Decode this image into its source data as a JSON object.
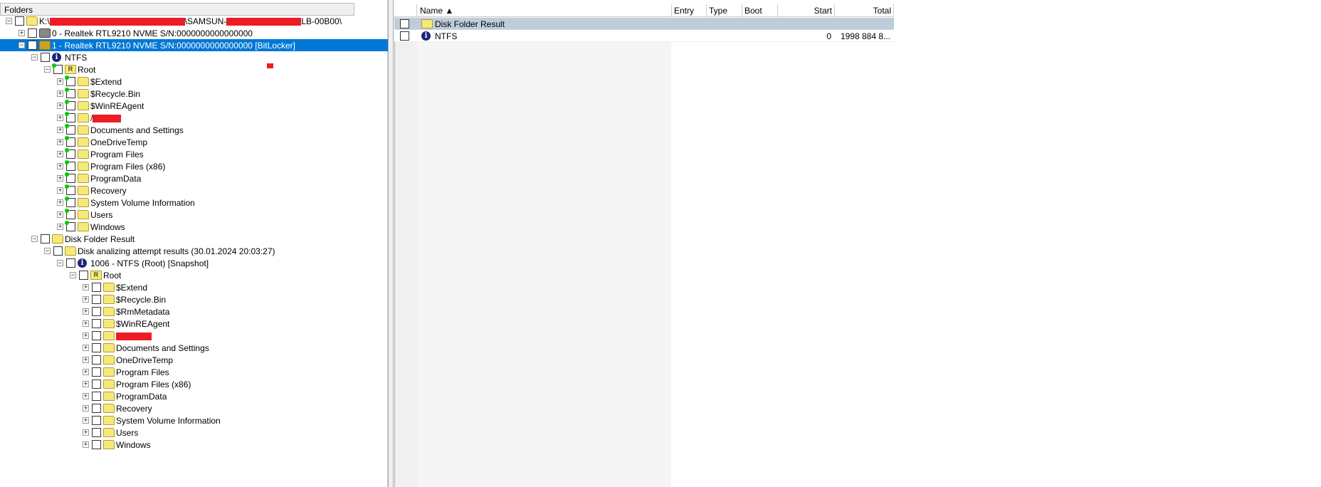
{
  "left_panel": {
    "header": "Folders"
  },
  "tree": [
    {
      "level": 0,
      "exp": "-",
      "icon": "drives",
      "text": "K:\\",
      "redact": [
        190,
        "\\SAMSUN-",
        105,
        "LB-00B00\\"
      ]
    },
    {
      "level": 1,
      "exp": "+",
      "icon": "disk",
      "text": "0 - Realtek RTL9210 NVME  S/N:0000000000000000"
    },
    {
      "level": 1,
      "exp": "-",
      "icon": "disk-lock",
      "text": "1 - Realtek RTL9210 NVME  S/N:0000000000000000 [BitLocker]",
      "selected": true
    },
    {
      "level": 2,
      "exp": "-",
      "icon": "info",
      "text": "NTFS"
    },
    {
      "level": 3,
      "exp": "-",
      "icon": "root",
      "text": "Root",
      "dot": true
    },
    {
      "level": 4,
      "exp": "+",
      "icon": "folder",
      "text": "$Extend",
      "dot": true
    },
    {
      "level": 4,
      "exp": "+",
      "icon": "folder",
      "text": "$Recycle.Bin",
      "dot": true
    },
    {
      "level": 4,
      "exp": "+",
      "icon": "folder",
      "text": "$WinREAgent",
      "dot": true
    },
    {
      "level": 4,
      "exp": "+",
      "icon": "folder",
      "text": "/",
      "dot": true,
      "redact": [
        40
      ]
    },
    {
      "level": 4,
      "exp": "+",
      "icon": "folder",
      "text": "Documents and Settings",
      "dot": true
    },
    {
      "level": 4,
      "exp": "+",
      "icon": "folder",
      "text": "OneDriveTemp",
      "dot": true
    },
    {
      "level": 4,
      "exp": "+",
      "icon": "folder",
      "text": "Program Files",
      "dot": true
    },
    {
      "level": 4,
      "exp": "+",
      "icon": "folder",
      "text": "Program Files (x86)",
      "dot": true
    },
    {
      "level": 4,
      "exp": "+",
      "icon": "folder",
      "text": "ProgramData",
      "dot": true
    },
    {
      "level": 4,
      "exp": "+",
      "icon": "folder",
      "text": "Recovery",
      "dot": true
    },
    {
      "level": 4,
      "exp": "+",
      "icon": "folder",
      "text": "System Volume Information",
      "dot": true
    },
    {
      "level": 4,
      "exp": "+",
      "icon": "folder",
      "text": "Users",
      "dot": true
    },
    {
      "level": 4,
      "exp": "+",
      "icon": "folder",
      "text": "Windows",
      "dot": true
    },
    {
      "level": 2,
      "exp": "-",
      "icon": "folder",
      "text": "Disk Folder Result"
    },
    {
      "level": 3,
      "exp": "-",
      "icon": "folder",
      "text": "Disk analizing attempt results (30.01.2024 20:03:27)"
    },
    {
      "level": 4,
      "exp": "-",
      "icon": "info",
      "text": "1006 - NTFS (Root)  [Snapshot]"
    },
    {
      "level": 5,
      "exp": "-",
      "icon": "root",
      "text": "Root"
    },
    {
      "level": 6,
      "exp": "+",
      "icon": "folder",
      "text": "$Extend"
    },
    {
      "level": 6,
      "exp": "+",
      "icon": "folder",
      "text": "$Recycle.Bin"
    },
    {
      "level": 6,
      "exp": "+",
      "icon": "folder",
      "text": "$RmMetadata"
    },
    {
      "level": 6,
      "exp": "+",
      "icon": "folder",
      "text": "$WinREAgent"
    },
    {
      "level": 6,
      "exp": "+",
      "icon": "folder",
      "text": "",
      "redact": [
        50
      ]
    },
    {
      "level": 6,
      "exp": "+",
      "icon": "folder",
      "text": "Documents and Settings"
    },
    {
      "level": 6,
      "exp": "+",
      "icon": "folder",
      "text": "OneDriveTemp"
    },
    {
      "level": 6,
      "exp": "+",
      "icon": "folder",
      "text": "Program Files"
    },
    {
      "level": 6,
      "exp": "+",
      "icon": "folder",
      "text": "Program Files (x86)"
    },
    {
      "level": 6,
      "exp": "+",
      "icon": "folder",
      "text": "ProgramData"
    },
    {
      "level": 6,
      "exp": "+",
      "icon": "folder",
      "text": "Recovery"
    },
    {
      "level": 6,
      "exp": "+",
      "icon": "folder",
      "text": "System Volume Information"
    },
    {
      "level": 6,
      "exp": "+",
      "icon": "folder",
      "text": "Users"
    },
    {
      "level": 6,
      "exp": "+",
      "icon": "folder",
      "text": "Windows"
    }
  ],
  "grid": {
    "columns": [
      "Name ▲",
      "Entry",
      "Type",
      "Boot",
      "Start",
      "Total"
    ],
    "rows": [
      {
        "icon": "folder",
        "name": "Disk Folder Result",
        "entry": "",
        "type": "",
        "boot": "",
        "start": "",
        "total": "",
        "selected": true
      },
      {
        "icon": "info",
        "name": "NTFS",
        "entry": "",
        "type": "",
        "boot": "",
        "start": "0",
        "total": "1998 884 8..."
      }
    ]
  },
  "colors": {
    "selection": "#0078d7",
    "grid_selection": "#bfcddb",
    "redaction": "#ed1c24"
  }
}
